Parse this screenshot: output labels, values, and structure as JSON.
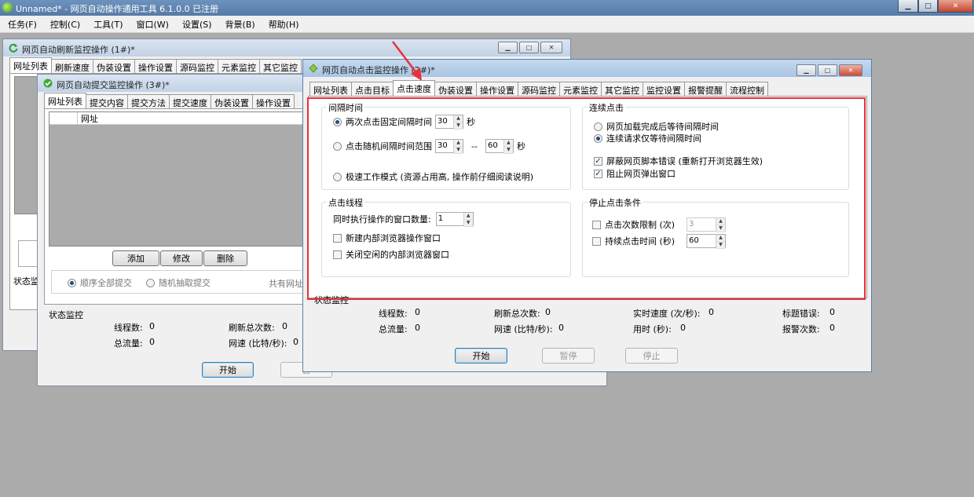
{
  "app": {
    "title": "Unnamed* - 网页自动操作通用工具 6.1.0.0  已注册"
  },
  "menu": [
    "任务(F)",
    "控制(C)",
    "工具(T)",
    "窗口(W)",
    "设置(S)",
    "背景(B)",
    "帮助(H)"
  ],
  "win1": {
    "title": "网页自动刷新监控操作 (1#)*",
    "tabs": [
      "网址列表",
      "刷新速度",
      "伪装设置",
      "操作设置",
      "源码监控",
      "元素监控",
      "其它监控"
    ],
    "status_fragment": "状态监"
  },
  "win3": {
    "title": "网页自动提交监控操作 (3#)*",
    "tabs": [
      "网址列表",
      "提交内容",
      "提交方法",
      "提交速度",
      "伪装设置",
      "操作设置"
    ],
    "col_header": "网址",
    "btn_add": "添加",
    "btn_edit": "修改",
    "btn_delete": "删除",
    "radio_seq": "顺序全部提交",
    "radio_random": "随机抽取提交",
    "share_frag": "共有网址",
    "status_title": "状态监控",
    "threads_label": "线程数:",
    "threads_val": "0",
    "refresh_label": "刷新总次数:",
    "refresh_val": "0",
    "traffic_label": "总流量:",
    "traffic_val": "0",
    "speed_label": "网速 (比特/秒):",
    "speed_val": "0",
    "btn_start": "开始",
    "btn_pause_frag": "暂"
  },
  "win2": {
    "title": "网页自动点击监控操作 (2#)*",
    "tabs": [
      "网址列表",
      "点击目标",
      "点击速度",
      "伪装设置",
      "操作设置",
      "源码监控",
      "元素监控",
      "其它监控",
      "监控设置",
      "报警提醒",
      "流程控制"
    ],
    "interval": {
      "legend": "间隔时间",
      "fixed_label": "两次点击固定间隔时间",
      "fixed_val": "30",
      "sec": "秒",
      "random_label": "点击随机间隔时间范围",
      "random_from": "30",
      "dash": "--",
      "random_to": "60",
      "fast_label": "极速工作模式 (资源占用高, 操作前仔细阅读说明)"
    },
    "continuous": {
      "legend": "连续点击",
      "opt1": "网页加载完成后等待间隔时间",
      "opt2": "连续请求仅等待间隔时间",
      "chk1": "屏蔽网页脚本错误 (重新打开浏览器生效)",
      "chk2": "阻止网页弹出窗口"
    },
    "threads": {
      "legend": "点击线程",
      "count_label": "同时执行操作的窗口数量:",
      "count_val": "1",
      "chk_new": "新建内部浏览器操作窗口",
      "chk_close": "关闭空闲的内部浏览器窗口"
    },
    "stop": {
      "legend": "停止点击条件",
      "count_label": "点击次数限制 (次)",
      "count_val": "3",
      "time_label": "持续点击时间 (秒)",
      "time_val": "60"
    },
    "status": {
      "title": "状态监控",
      "threads_label": "线程数:",
      "threads_val": "0",
      "refresh_label": "刷新总次数:",
      "refresh_val": "0",
      "rt_label": "实时速度 (次/秒):",
      "rt_val": "0",
      "title_err_label": "标题错误:",
      "title_err_val": "0",
      "traffic_label": "总流量:",
      "traffic_val": "0",
      "net_label": "网速 (比特/秒):",
      "net_val": "0",
      "elapsed_label": "用时 (秒):",
      "elapsed_val": "0",
      "alarm_label": "报警次数:",
      "alarm_val": "0"
    },
    "btn_start": "开始",
    "btn_pause": "暂停",
    "btn_stop": "停止"
  },
  "colors": {
    "highlight": "#e8313b",
    "titlebar": "#6d93bd"
  }
}
